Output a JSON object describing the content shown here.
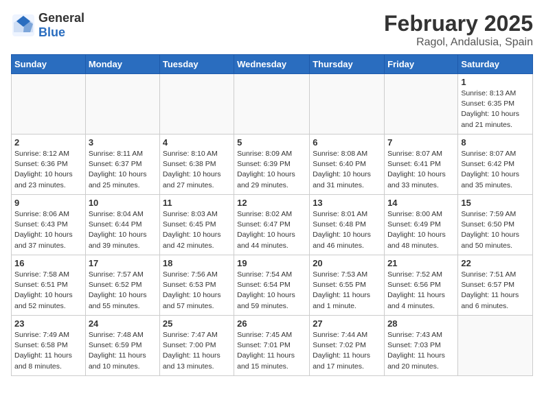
{
  "header": {
    "logo_general": "General",
    "logo_blue": "Blue",
    "title": "February 2025",
    "subtitle": "Ragol, Andalusia, Spain"
  },
  "days_of_week": [
    "Sunday",
    "Monday",
    "Tuesday",
    "Wednesday",
    "Thursday",
    "Friday",
    "Saturday"
  ],
  "weeks": [
    [
      {
        "day": "",
        "info": ""
      },
      {
        "day": "",
        "info": ""
      },
      {
        "day": "",
        "info": ""
      },
      {
        "day": "",
        "info": ""
      },
      {
        "day": "",
        "info": ""
      },
      {
        "day": "",
        "info": ""
      },
      {
        "day": "1",
        "info": "Sunrise: 8:13 AM\nSunset: 6:35 PM\nDaylight: 10 hours and 21 minutes."
      }
    ],
    [
      {
        "day": "2",
        "info": "Sunrise: 8:12 AM\nSunset: 6:36 PM\nDaylight: 10 hours and 23 minutes."
      },
      {
        "day": "3",
        "info": "Sunrise: 8:11 AM\nSunset: 6:37 PM\nDaylight: 10 hours and 25 minutes."
      },
      {
        "day": "4",
        "info": "Sunrise: 8:10 AM\nSunset: 6:38 PM\nDaylight: 10 hours and 27 minutes."
      },
      {
        "day": "5",
        "info": "Sunrise: 8:09 AM\nSunset: 6:39 PM\nDaylight: 10 hours and 29 minutes."
      },
      {
        "day": "6",
        "info": "Sunrise: 8:08 AM\nSunset: 6:40 PM\nDaylight: 10 hours and 31 minutes."
      },
      {
        "day": "7",
        "info": "Sunrise: 8:07 AM\nSunset: 6:41 PM\nDaylight: 10 hours and 33 minutes."
      },
      {
        "day": "8",
        "info": "Sunrise: 8:07 AM\nSunset: 6:42 PM\nDaylight: 10 hours and 35 minutes."
      }
    ],
    [
      {
        "day": "9",
        "info": "Sunrise: 8:06 AM\nSunset: 6:43 PM\nDaylight: 10 hours and 37 minutes."
      },
      {
        "day": "10",
        "info": "Sunrise: 8:04 AM\nSunset: 6:44 PM\nDaylight: 10 hours and 39 minutes."
      },
      {
        "day": "11",
        "info": "Sunrise: 8:03 AM\nSunset: 6:45 PM\nDaylight: 10 hours and 42 minutes."
      },
      {
        "day": "12",
        "info": "Sunrise: 8:02 AM\nSunset: 6:47 PM\nDaylight: 10 hours and 44 minutes."
      },
      {
        "day": "13",
        "info": "Sunrise: 8:01 AM\nSunset: 6:48 PM\nDaylight: 10 hours and 46 minutes."
      },
      {
        "day": "14",
        "info": "Sunrise: 8:00 AM\nSunset: 6:49 PM\nDaylight: 10 hours and 48 minutes."
      },
      {
        "day": "15",
        "info": "Sunrise: 7:59 AM\nSunset: 6:50 PM\nDaylight: 10 hours and 50 minutes."
      }
    ],
    [
      {
        "day": "16",
        "info": "Sunrise: 7:58 AM\nSunset: 6:51 PM\nDaylight: 10 hours and 52 minutes."
      },
      {
        "day": "17",
        "info": "Sunrise: 7:57 AM\nSunset: 6:52 PM\nDaylight: 10 hours and 55 minutes."
      },
      {
        "day": "18",
        "info": "Sunrise: 7:56 AM\nSunset: 6:53 PM\nDaylight: 10 hours and 57 minutes."
      },
      {
        "day": "19",
        "info": "Sunrise: 7:54 AM\nSunset: 6:54 PM\nDaylight: 10 hours and 59 minutes."
      },
      {
        "day": "20",
        "info": "Sunrise: 7:53 AM\nSunset: 6:55 PM\nDaylight: 11 hours and 1 minute."
      },
      {
        "day": "21",
        "info": "Sunrise: 7:52 AM\nSunset: 6:56 PM\nDaylight: 11 hours and 4 minutes."
      },
      {
        "day": "22",
        "info": "Sunrise: 7:51 AM\nSunset: 6:57 PM\nDaylight: 11 hours and 6 minutes."
      }
    ],
    [
      {
        "day": "23",
        "info": "Sunrise: 7:49 AM\nSunset: 6:58 PM\nDaylight: 11 hours and 8 minutes."
      },
      {
        "day": "24",
        "info": "Sunrise: 7:48 AM\nSunset: 6:59 PM\nDaylight: 11 hours and 10 minutes."
      },
      {
        "day": "25",
        "info": "Sunrise: 7:47 AM\nSunset: 7:00 PM\nDaylight: 11 hours and 13 minutes."
      },
      {
        "day": "26",
        "info": "Sunrise: 7:45 AM\nSunset: 7:01 PM\nDaylight: 11 hours and 15 minutes."
      },
      {
        "day": "27",
        "info": "Sunrise: 7:44 AM\nSunset: 7:02 PM\nDaylight: 11 hours and 17 minutes."
      },
      {
        "day": "28",
        "info": "Sunrise: 7:43 AM\nSunset: 7:03 PM\nDaylight: 11 hours and 20 minutes."
      },
      {
        "day": "",
        "info": ""
      }
    ]
  ]
}
